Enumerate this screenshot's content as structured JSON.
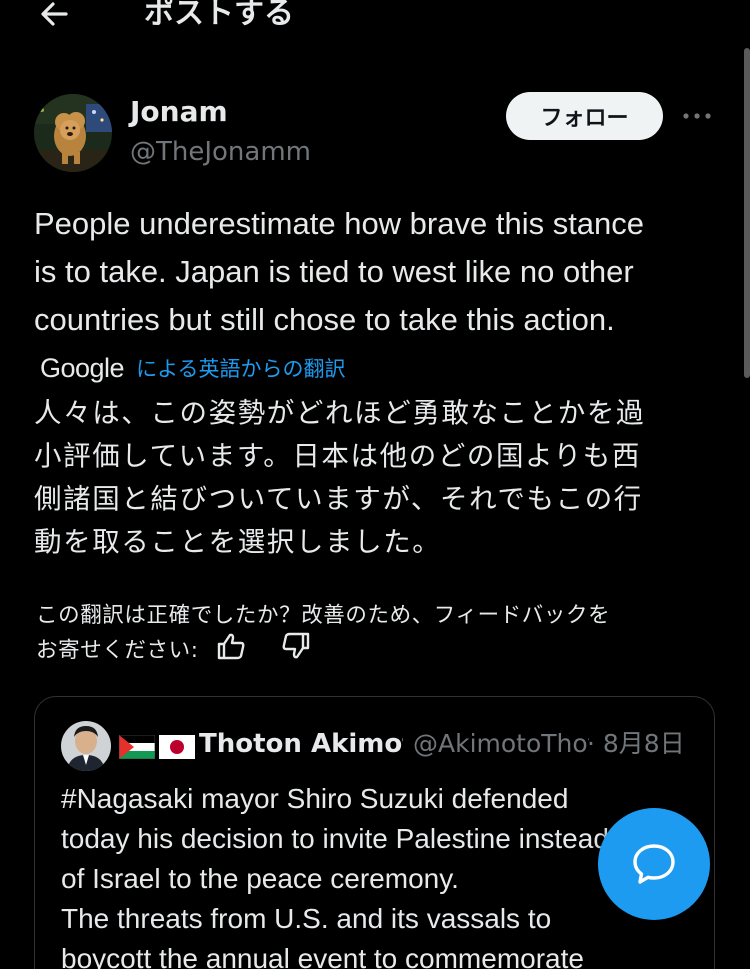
{
  "header": {
    "title": "ポストする",
    "back_icon": "arrow-left-icon"
  },
  "author": {
    "name": "Jonam",
    "handle": "@TheJonamm",
    "follow_label": "フォロー",
    "more_icon": "more-horizontal-icon"
  },
  "tweet": {
    "lines": [
      "People underestimate how brave this stance",
      "is to take. Japan is tied to west like no other",
      "countries but still chose to take this action."
    ]
  },
  "translation": {
    "provider": "Google",
    "label": "による英語からの翻訳",
    "lines": [
      "人々は、この姿勢がどれほど勇敢なことかを過",
      "小評価しています。日本は他のどの国よりも西",
      "側諸国と結びついていますが、それでもこの行",
      "動を取ることを選択しました。"
    ],
    "feedback_line1": "この翻訳は正確でしたか？改善のため、フィードバックを",
    "feedback_line2": "お寄せください:",
    "thumbs_up_icon": "thumbs-up-icon",
    "thumbs_down_icon": "thumbs-down-icon"
  },
  "quote": {
    "name": "Thoton Akimoto",
    "handle": "@AkimotoThoton",
    "date": "· 8月8日",
    "flags": [
      "palestine-flag-icon",
      "japan-flag-icon"
    ],
    "lines": [
      "#Nagasaki mayor Shiro Suzuki defended",
      "today his decision to invite Palestine instead",
      "of Israel to the peace ceremony.",
      "The threats from U.S. and its vassals to",
      "boycott the annual event to commemorate"
    ]
  },
  "fab": {
    "icon": "chat-bubble-icon"
  },
  "colors": {
    "background": "#000000",
    "text": "#e7e9ea",
    "secondary": "#71767b",
    "accent": "#1d9bf0",
    "border": "#2f3336"
  }
}
